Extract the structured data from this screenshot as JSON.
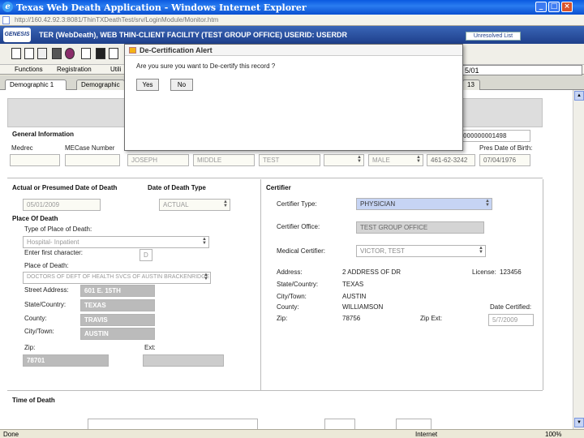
{
  "window": {
    "title": "Texas Web Death Application - Windows Internet Explorer",
    "url": "http://160.42.92.3:8081/ThinTXDeathTest/srv/LoginModule/Monitor.htm",
    "btn_min": "_",
    "btn_max": "□",
    "btn_close": "×"
  },
  "app": {
    "logo_text": "GENESIS",
    "title": "TER (WebDeath), WEB THIN-CLIENT FACILITY (TEST GROUP OFFICE) USERID: USERDR",
    "unresolved_label": "Unresolved List"
  },
  "menu": {
    "items": [
      "Functions",
      "Registration",
      "Utili"
    ]
  },
  "header_date": "5/01",
  "tabs": [
    {
      "label": "Demographic 1"
    },
    {
      "label": "Demographic"
    },
    {
      "label": "13"
    }
  ],
  "general": {
    "title": "General Information",
    "medrec_label": "Medrec",
    "mecase_label": "MECase Number",
    "record_no": "000000001498",
    "first_name": "JOSEPH",
    "middle_name": "MIDDLE",
    "last_name": "TEST",
    "sex": "MALE",
    "ssn": "461-62-3242",
    "dob_label": "Pres Date of Birth:",
    "dob": "07/04/1976"
  },
  "death": {
    "title": "Actual or Presumed Date of Death",
    "date": "05/01/2009",
    "type_title": "Date of Death Type",
    "type_value": "ACTUAL",
    "place_title": "Place Of Death",
    "type_place_label": "Type of Place of Death:",
    "type_place_value": "Hospital- Inpatient",
    "first_char_label": "Enter first character:",
    "first_char_value": "D",
    "place_label": "Place of Death:",
    "place_value": "DOCTORS OF DEFT OF HEALTH SVCS OF AUSTIN BRACKENRIDGE",
    "street_label": "Street Address:",
    "street_value": "601 E. 15TH",
    "state_label": "State/Country:",
    "state_value": "TEXAS",
    "county_label": "County:",
    "county_value": "TRAVIS",
    "city_label": "City/Town:",
    "city_value": "AUSTIN",
    "zip_label": "Zip:",
    "zip_value": "78701",
    "ext_label": "Ext:"
  },
  "certifier": {
    "title": "Certifier",
    "type_label": "Certifier Type:",
    "type_value": "PHYSICIAN",
    "office_label": "Certifier Office:",
    "office_value": "TEST GROUP OFFICE",
    "medical_label": "Medical Certifier:",
    "medical_value": "VICTOR, TEST",
    "address_label": "Address:",
    "address_value": "2 ADDRESS OF DR",
    "license_label": "License:",
    "license_value": "123456",
    "state_label": "State/Country:",
    "state_value": "TEXAS",
    "city_label": "City/Town:",
    "city_value": "AUSTIN",
    "county_label": "County:",
    "county_value": "WILLIAMSON",
    "date_cert_label": "Date Certified:",
    "date_cert_value": "5/7/2009",
    "zip_label": "Zip:",
    "zip_value": "78756",
    "zipext_label": "Zip Ext:"
  },
  "time_of_death": {
    "title": "Time of Death"
  },
  "dialog": {
    "title": "De-Certification Alert",
    "message": "Are you sure you want to De-certify this record ?",
    "yes": "Yes",
    "no": "No"
  },
  "status": {
    "left": "Done",
    "zone": "Internet",
    "zoom": "100%"
  },
  "colors": {
    "titlebar": "#0a58e0",
    "banner": "#1e3f8a",
    "selected_field": "#c6d4f4"
  }
}
